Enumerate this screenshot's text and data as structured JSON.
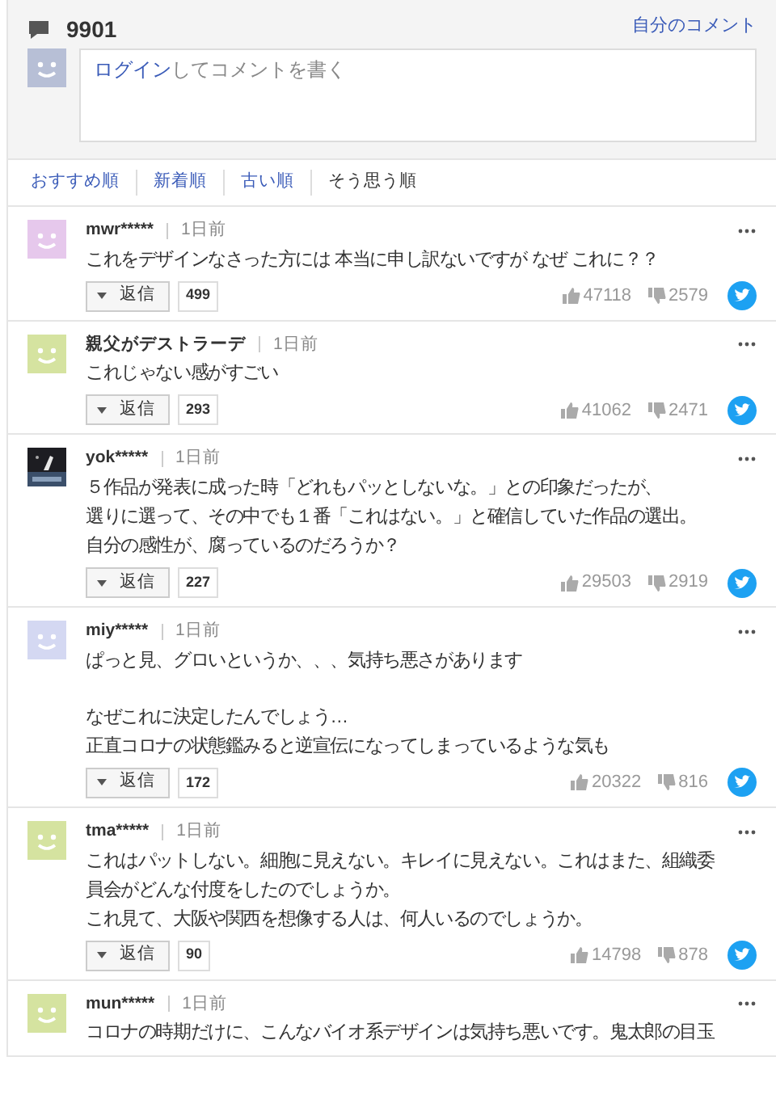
{
  "header": {
    "count": "9901",
    "my_comments_link": "自分のコメント",
    "comment_box": {
      "login_link": "ログイン",
      "placeholder_rest": "してコメントを書く"
    }
  },
  "sort_tabs": [
    {
      "label": "おすすめ順",
      "selected": false
    },
    {
      "label": "新着順",
      "selected": false
    },
    {
      "label": "古い順",
      "selected": false
    },
    {
      "label": "そう思う順",
      "selected": true
    }
  ],
  "comments": [
    {
      "user": "mwr*****",
      "time": "1日前",
      "avatar": {
        "kind": "face",
        "color": "#e6c8ec"
      },
      "paragraphs": [
        [
          "これをデザインなさった方には 本当に申し訳ないですが なぜ これに？？"
        ]
      ],
      "reply_label": "返信",
      "reply_count": "499",
      "likes": "47118",
      "dislikes": "2579"
    },
    {
      "user": "親父がデストラーデ",
      "time": "1日前",
      "avatar": {
        "kind": "face",
        "color": "#d5e3a0"
      },
      "paragraphs": [
        [
          "これじゃない感がすごい"
        ]
      ],
      "reply_label": "返信",
      "reply_count": "293",
      "likes": "41062",
      "dislikes": "2471"
    },
    {
      "user": "yok*****",
      "time": "1日前",
      "avatar": {
        "kind": "picture"
      },
      "paragraphs": [
        [
          "５作品が発表に成った時「どれもパッとしないな。」との印象だったが、",
          "選りに選って、その中でも１番「これはない。」と確信していた作品の選出。",
          "自分の感性が、腐っているのだろうか？"
        ]
      ],
      "reply_label": "返信",
      "reply_count": "227",
      "likes": "29503",
      "dislikes": "2919"
    },
    {
      "user": "miy*****",
      "time": "1日前",
      "avatar": {
        "kind": "face",
        "color": "#d4d8f2"
      },
      "paragraphs": [
        [
          "ぱっと見、グロいというか、、、気持ち悪さがあります"
        ],
        [
          "なぜこれに決定したんでしょう…",
          "正直コロナの状態鑑みると逆宣伝になってしまっているような気も"
        ]
      ],
      "reply_label": "返信",
      "reply_count": "172",
      "likes": "20322",
      "dislikes": "816"
    },
    {
      "user": "tma*****",
      "time": "1日前",
      "avatar": {
        "kind": "face",
        "color": "#d5e3a0"
      },
      "paragraphs": [
        [
          "これはパットしない。細胞に見えない。キレイに見えない。これはまた、組織委",
          "員会がどんな付度をしたのでしょうか。",
          "これ見て、大阪や関西を想像する人は、何人いるのでしょうか。"
        ]
      ],
      "reply_label": "返信",
      "reply_count": "90",
      "likes": "14798",
      "dislikes": "878"
    },
    {
      "user": "mun*****",
      "time": "1日前",
      "avatar": {
        "kind": "face",
        "color": "#d5e3a0"
      },
      "paragraphs": [
        [
          "コロナの時期だけに、こんなバイオ系デザインは気持ち悪いです。鬼太郎の目玉"
        ]
      ]
    }
  ]
}
